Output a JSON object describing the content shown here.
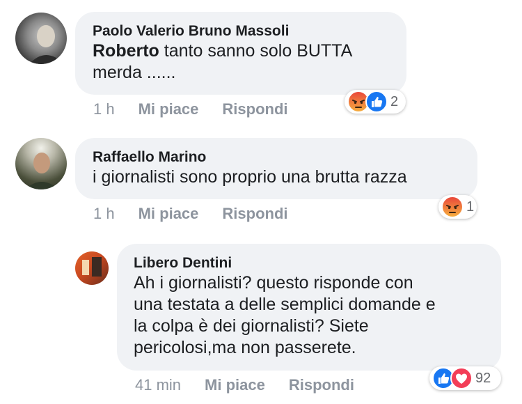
{
  "comments": [
    {
      "author": "Paolo Valerio Bruno Massoli",
      "mention": "Roberto",
      "text_line1": " tanto sanno solo BUTTA",
      "text_line2": "merda ......",
      "time": "1 h",
      "like_label": "Mi piace",
      "reply_label": "Rispondi",
      "reactions": [
        "angry-icon",
        "like-icon"
      ],
      "reaction_count": "2"
    },
    {
      "author": "Raffaello Marino",
      "text_line1": "i giornalisti sono proprio una brutta razza",
      "time": "1 h",
      "like_label": "Mi piace",
      "reply_label": "Rispondi",
      "reactions": [
        "angry-icon"
      ],
      "reaction_count": "1"
    },
    {
      "author": "Libero Dentini",
      "text_line1": "Ah i giornalisti? questo risponde con",
      "text_line2": "una testata a delle semplici domande e",
      "text_line3": "la colpa è dei giornalisti? Siete",
      "text_line4": "pericolosi,ma non passerete.",
      "time": "41 min",
      "like_label": "Mi piace",
      "reply_label": "Rispondi",
      "reactions": [
        "like-icon",
        "love-icon"
      ],
      "reaction_count": "92"
    }
  ],
  "colors": {
    "bubble": "#f0f2f5",
    "meta": "#8d949e",
    "like_blue": "#1877f2",
    "love_red": "#f33e58",
    "angry_orange": "#f07c25"
  }
}
